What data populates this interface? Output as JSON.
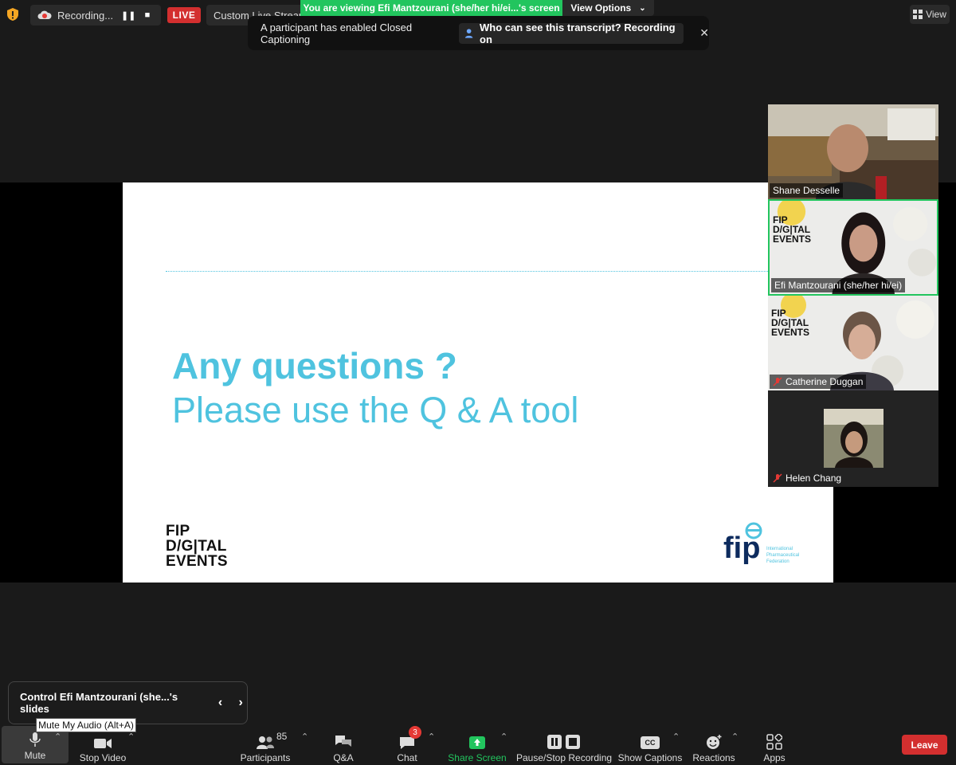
{
  "top_bar": {
    "recording_label": "Recording...",
    "live_label": "LIVE",
    "stream_service": "Custom Live Streaming Service",
    "viewing_banner": "You are viewing Efi Mantzourani (she/her hi/ei...'s screen",
    "view_options": "View Options",
    "view_label": "View"
  },
  "cc_toast": {
    "message": "A participant has enabled Closed Captioning",
    "link": "Who can see this transcript? Recording on"
  },
  "slide": {
    "title": "Any questions ?",
    "subtitle": "Please use the Q & A tool",
    "brand_line1": "FIP",
    "brand_line2": "D/G|TAL",
    "brand_line3": "EVENTS",
    "fip_wordmark": "fip",
    "fip_tagline1": "International",
    "fip_tagline2": "Pharmaceutical",
    "fip_tagline3": "Federation"
  },
  "participants_gallery": [
    {
      "name": "Shane Desselle",
      "muted": false,
      "active": false
    },
    {
      "name": "Efi Mantzourani (she/her hi/ei)",
      "muted": false,
      "active": true
    },
    {
      "name": "Catherine Duggan",
      "muted": true,
      "active": false
    },
    {
      "name": "Helen Chang",
      "muted": true,
      "active": false
    }
  ],
  "gallery_logo": {
    "line1": "FIP",
    "line2": "D/G|TAL",
    "line3": "EVENTS"
  },
  "remote_control": {
    "label": "Control Efi Mantzourani (she...'s slides",
    "prev": "‹",
    "next": "›"
  },
  "tooltip": "Mute My Audio (Alt+A)",
  "toolbar": {
    "mute": "Mute",
    "stop_video": "Stop Video",
    "participants": "Participants",
    "participant_count": "85",
    "qa": "Q&A",
    "chat": "Chat",
    "chat_badge": "3",
    "share_screen": "Share Screen",
    "recording": "Pause/Stop Recording",
    "captions": "Show Captions",
    "cc_icon_text": "CC",
    "reactions": "Reactions",
    "apps": "Apps",
    "leave": "Leave"
  },
  "colors": {
    "accent_green": "#22c55e",
    "live_red": "#d32f2f",
    "slide_blue": "#4fc3df"
  }
}
